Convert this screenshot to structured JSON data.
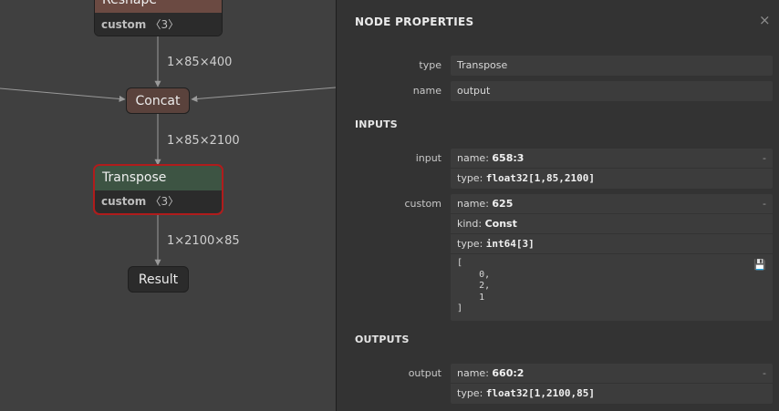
{
  "graph": {
    "nodes": {
      "reshape": {
        "title": "Reshape",
        "attr_name": "custom",
        "attr_count": "〈3〉"
      },
      "concat": {
        "title": "Concat"
      },
      "transpose": {
        "title": "Transpose",
        "attr_name": "custom",
        "attr_count": "〈3〉"
      },
      "result": {
        "title": "Result"
      }
    },
    "edges": {
      "reshape_concat": "1×85×400",
      "concat_transpose": "1×85×2100",
      "transpose_result": "1×2100×85"
    },
    "colors": {
      "reshape_header": "#6b4a42",
      "concat_fill": "#5a423c",
      "transpose_header": "#3d5443",
      "selection": "#b01c1c"
    }
  },
  "panel": {
    "title": "NODE PROPERTIES",
    "close_icon": "×",
    "properties": [
      {
        "label": "type",
        "value": "Transpose"
      },
      {
        "label": "name",
        "value": "output"
      }
    ],
    "inputs_title": "INPUTS",
    "inputs": {
      "input": {
        "label": "input",
        "name_key": "name: ",
        "name_value": "658:3",
        "type_key": "type: ",
        "type_value": "float32[1,85,2100]",
        "toggle": "-"
      },
      "custom": {
        "label": "custom",
        "name_key": "name: ",
        "name_value": "625",
        "kind_key": "kind: ",
        "kind_value": "Const",
        "type_key": "type: ",
        "type_value": "int64[3]",
        "toggle": "-",
        "tensor": "[\n    0,\n    2,\n    1\n]",
        "save_icon": "💾"
      }
    },
    "outputs_title": "OUTPUTS",
    "outputs": {
      "output": {
        "label": "output",
        "name_key": "name: ",
        "name_value": "660:2",
        "type_key": "type: ",
        "type_value": "float32[1,2100,85]",
        "toggle": "-"
      }
    }
  }
}
